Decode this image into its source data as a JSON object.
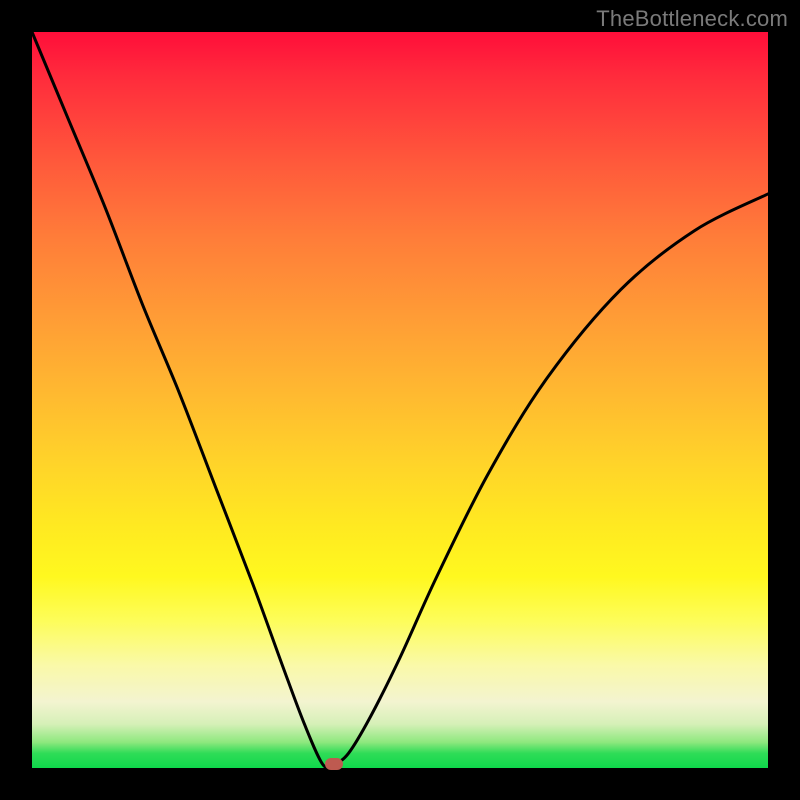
{
  "watermark": "TheBottleneck.com",
  "colors": {
    "frame": "#000000",
    "curve": "#000000",
    "marker": "#be5a50",
    "gradient_top": "#ff0e3a",
    "gradient_bottom": "#0fd84b"
  },
  "chart_data": {
    "type": "line",
    "title": "",
    "xlabel": "",
    "ylabel": "",
    "xlim": [
      0,
      1
    ],
    "ylim": [
      0,
      1
    ],
    "grid": false,
    "legend": false,
    "annotations": [
      {
        "text": "TheBottleneck.com",
        "position": "top-right"
      }
    ],
    "series": [
      {
        "name": "bottleneck-curve",
        "comment": "V-shaped curve; y is distance from optimum (0 = no bottleneck, 1 = max). Values estimated from pixels.",
        "x": [
          0.0,
          0.05,
          0.1,
          0.15,
          0.2,
          0.25,
          0.3,
          0.34,
          0.37,
          0.395,
          0.41,
          0.43,
          0.46,
          0.5,
          0.55,
          0.62,
          0.7,
          0.8,
          0.9,
          1.0
        ],
        "y": [
          1.0,
          0.88,
          0.76,
          0.63,
          0.51,
          0.38,
          0.25,
          0.14,
          0.06,
          0.005,
          0.005,
          0.02,
          0.07,
          0.15,
          0.26,
          0.4,
          0.53,
          0.65,
          0.73,
          0.78
        ]
      }
    ],
    "marker": {
      "x": 0.41,
      "y": 0.006
    },
    "background_gradient": {
      "orientation": "vertical",
      "stops": [
        {
          "pos": 0.0,
          "color": "#ff0e3a"
        },
        {
          "pos": 0.28,
          "color": "#ff7d39"
        },
        {
          "pos": 0.58,
          "color": "#ffd22a"
        },
        {
          "pos": 0.8,
          "color": "#fdfd5a"
        },
        {
          "pos": 0.94,
          "color": "#d6f0b8"
        },
        {
          "pos": 1.0,
          "color": "#0fd84b"
        }
      ]
    }
  }
}
